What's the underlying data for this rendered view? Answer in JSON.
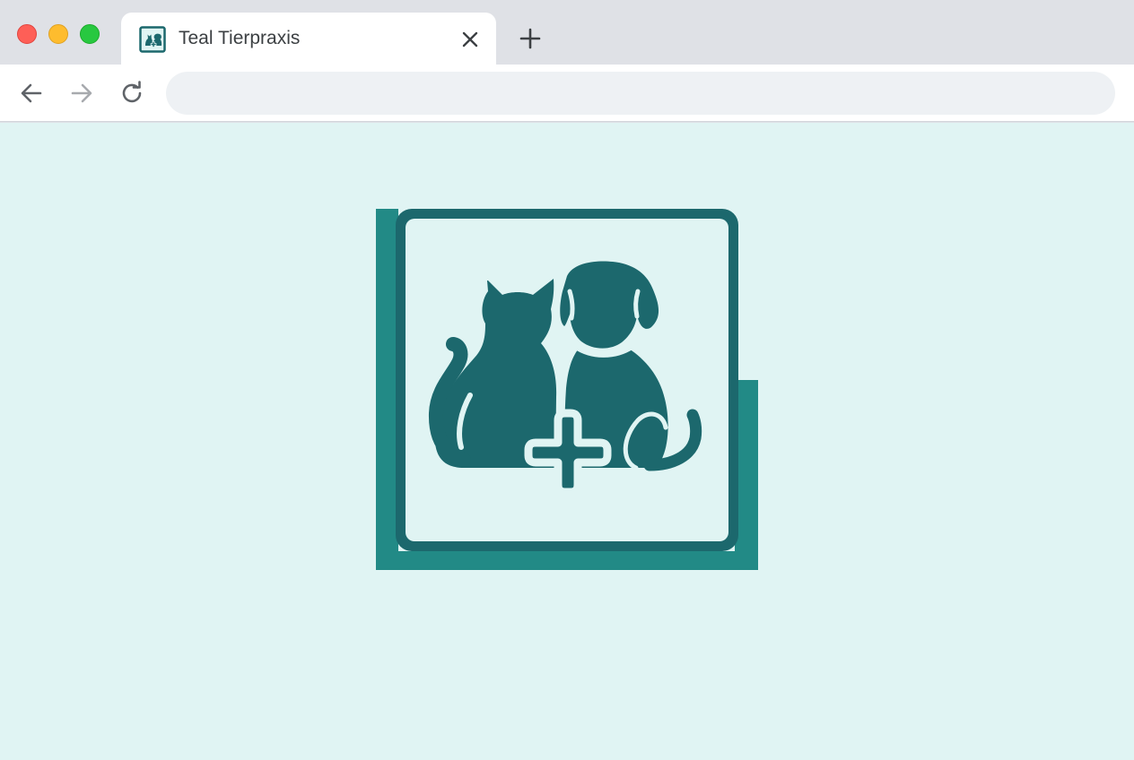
{
  "window": {
    "controls": {
      "close_color": "#fe5f57",
      "minimize_color": "#febc2e",
      "maximize_color": "#28c840"
    }
  },
  "tabs": [
    {
      "title": "Teal Tierpraxis",
      "favicon": "vet-cat-dog-icon",
      "active": true
    }
  ],
  "toolbar": {
    "back_icon": "arrow-left-icon",
    "forward_icon": "arrow-right-icon",
    "reload_icon": "reload-icon",
    "address": {
      "value": "",
      "placeholder": ""
    }
  },
  "content": {
    "background": "#e0f4f3",
    "logo": {
      "icon": "vet-cat-dog-cross-logo",
      "primary_color": "#1c686d",
      "shadow_color": "#228a86"
    }
  }
}
